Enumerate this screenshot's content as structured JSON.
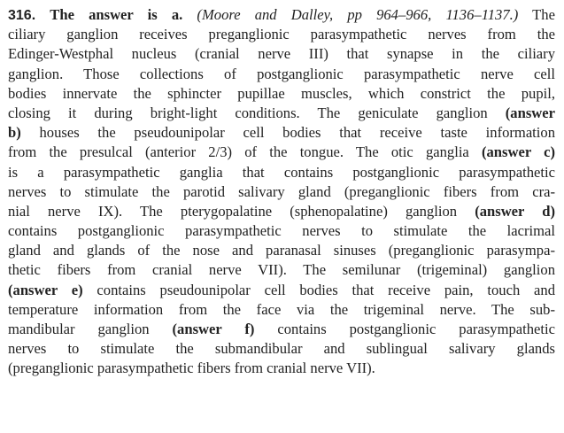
{
  "question_number": "316.",
  "answer_heading": "The answer is a.",
  "reference": "(Moore and Dalley, pp 964–966, 1136–1137.)",
  "lines": [
    [
      {
        "t": "The"
      }
    ],
    [
      {
        "t": "ciliary ganglion receives preganglionic parasympathetic nerves from the"
      }
    ],
    [
      {
        "t": "Edinger-Westphal nucleus (cranial nerve III) that synapse in the ciliary"
      }
    ],
    [
      {
        "t": "ganglion. Those collections of postganglionic parasympathetic nerve cell"
      }
    ],
    [
      {
        "t": "bodies innervate the sphincter pupillae muscles, which constrict the pupil,"
      }
    ],
    [
      {
        "t": "closing it during bright-light conditions. The geniculate ganglion "
      },
      {
        "t": "(answer",
        "b": true
      }
    ],
    [
      {
        "t": "b)",
        "b": true
      },
      {
        "t": " houses the pseudounipolar cell bodies that receive taste information"
      }
    ],
    [
      {
        "t": "from the presulcal (anterior 2/3) of the tongue. The otic ganglia "
      },
      {
        "t": "(answer c)",
        "b": true
      }
    ],
    [
      {
        "t": "is a parasympathetic ganglia that contains postganglionic parasympathetic"
      }
    ],
    [
      {
        "t": "nerves to stimulate the parotid salivary gland (preganglionic fibers from cra-"
      }
    ],
    [
      {
        "t": "nial nerve IX). The pterygopalatine (sphenopalatine) ganglion "
      },
      {
        "t": "(answer d)",
        "b": true
      }
    ],
    [
      {
        "t": "contains postganglionic parasympathetic nerves to stimulate the lacrimal"
      }
    ],
    [
      {
        "t": "gland and glands of the nose and paranasal sinuses (preganglionic parasympa-"
      }
    ],
    [
      {
        "t": "thetic fibers from cranial nerve VII). The semilunar (trigeminal) ganglion"
      }
    ],
    [
      {
        "t": "(answer e)",
        "b": true
      },
      {
        "t": " contains pseudounipolar cell bodies that receive pain, touch and"
      }
    ],
    [
      {
        "t": "temperature information from the face via the trigeminal nerve. The sub-"
      }
    ],
    [
      {
        "t": "mandibular ganglion "
      },
      {
        "t": "(answer f)",
        "b": true
      },
      {
        "t": " contains postganglionic parasympathetic"
      }
    ],
    [
      {
        "t": "nerves to stimulate the submandibular and sublingual salivary glands"
      }
    ],
    [
      {
        "t": "(preganglionic parasympathetic fibers from cranial nerve VII)."
      }
    ]
  ]
}
